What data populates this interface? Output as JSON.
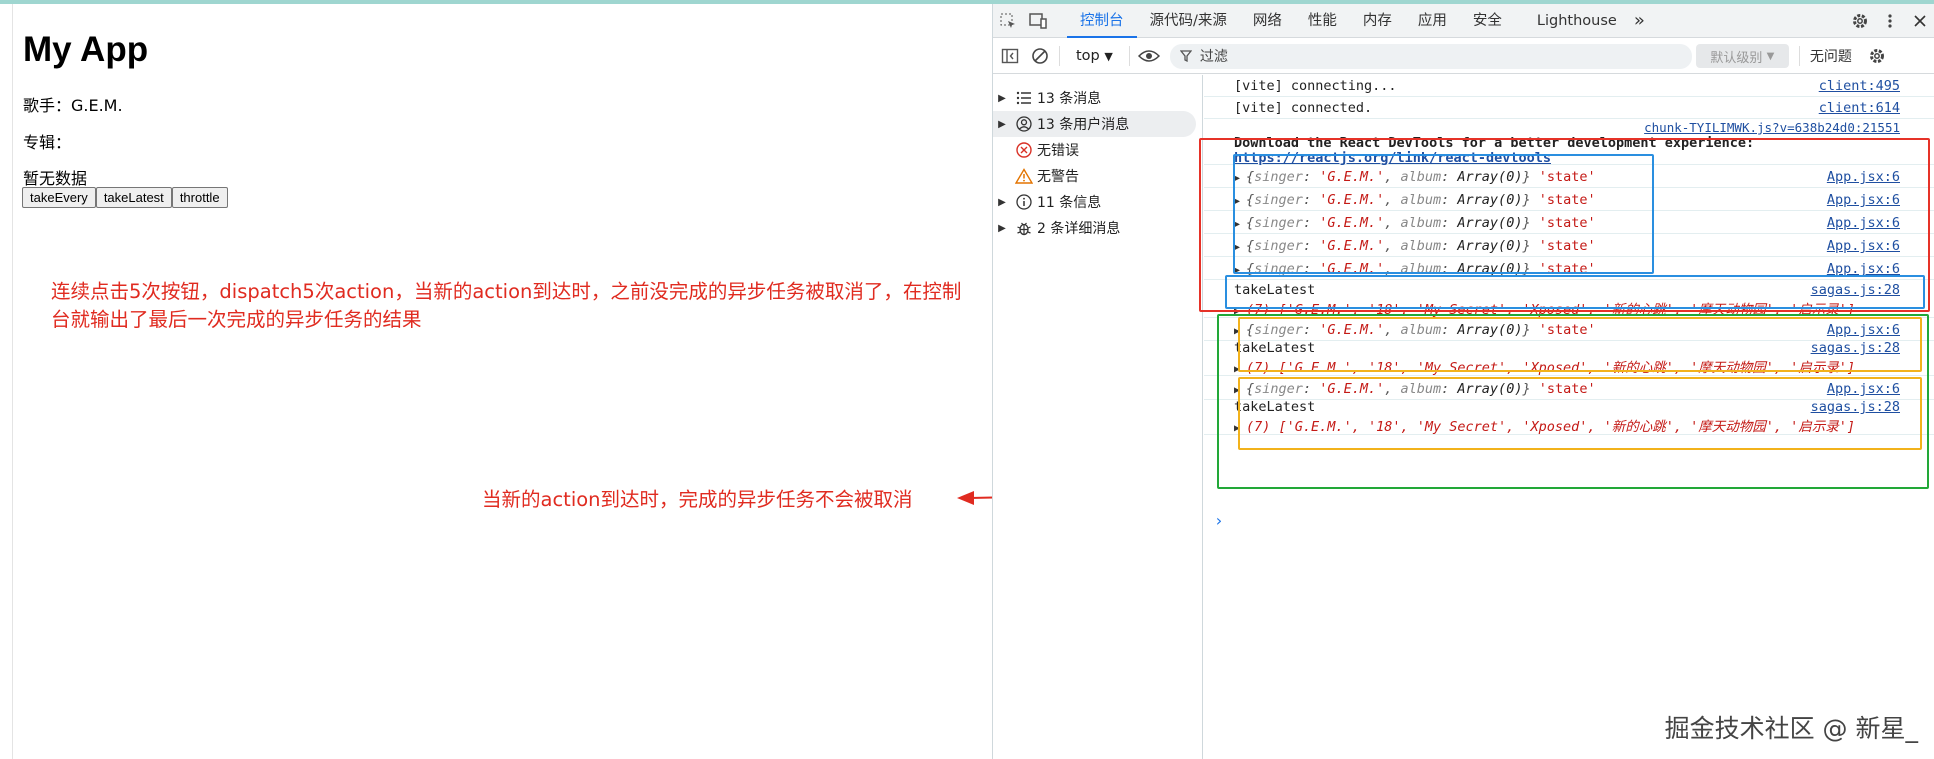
{
  "app": {
    "title": "My App",
    "singer_line": "歌手：G.E.M.",
    "album_line": "专辑：",
    "empty_text": "暂无数据",
    "buttons": [
      "takeEvery",
      "takeLatest",
      "throttle"
    ]
  },
  "annotations": {
    "first": [
      "连续点击5次按钮，dispatch5次action，当新的action到达时，之前没完成的异步任务被取消了，在控制",
      "台就输出了最后一次完成的异步任务的结果"
    ],
    "second": "当新的action到达时，完成的异步任务不会被取消"
  },
  "devtools": {
    "tabs": [
      "控制台",
      "源代码/来源",
      "网络",
      "性能",
      "内存",
      "应用",
      "安全",
      "Lighthouse"
    ],
    "active_tab": "控制台",
    "more": "»",
    "context": "top",
    "filter_placeholder": "过滤",
    "level": "默认级别",
    "issues": "无问题",
    "sidebar": [
      {
        "label": "13 条消息",
        "icon": "list-icon"
      },
      {
        "label": "13 条用户消息",
        "icon": "user-icon"
      },
      {
        "label": "无错误",
        "icon": "error-icon"
      },
      {
        "label": "无警告",
        "icon": "warning-icon"
      },
      {
        "label": "11 条信息",
        "icon": "info-icon"
      },
      {
        "label": "2 条详细消息",
        "icon": "bug-icon"
      }
    ],
    "console": {
      "vite1": {
        "text": "[vite] connecting...",
        "src": "client:495"
      },
      "vite2": {
        "text": "[vite] connected.",
        "src": "client:614"
      },
      "chunk_src": "chunk-TYILIMWK.js?v=638b24d0:21551",
      "devtools_msg": "Download the React DevTools for a better experience:",
      "devtools_msg_full": "Download the React DevTools for a better development experience:",
      "devtools_link": "https://reactjs.org/link/react-devtools",
      "state_obj": {
        "open": "{",
        "singer_key": "singer",
        "singer_val": "'G.E.M.'",
        "album_key": "album",
        "album_val": "Array(0)",
        "close": "}",
        "label": "'state'",
        "src": "App.jsx:6"
      },
      "takeLatest_label": "takeLatest",
      "saga_src": "sagas.js:28",
      "array_preview": "(7) ['G.E.M.', '18', 'My Secret', 'Xposed', '新的心跳', '摩天动物园', '启示录']",
      "prompt": "›"
    }
  },
  "watermark": "掘金技术社区 @ 新星_",
  "colors": {
    "red_annotation": "#e02b20",
    "blue_box": "#2a8fe0",
    "green_box": "#22a838",
    "orange_box": "#f2b21b",
    "link": "#1f4fa1"
  }
}
